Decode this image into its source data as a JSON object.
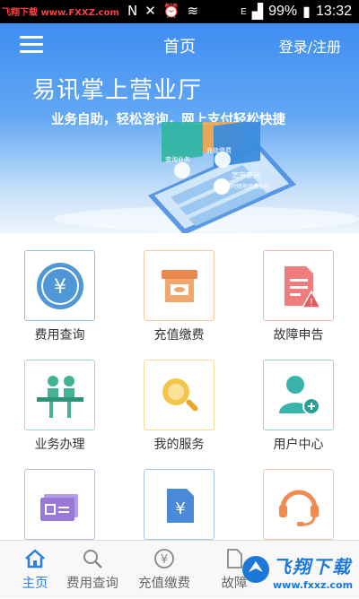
{
  "statusbar": {
    "watermark": "飞翔下载 www.FXXZ.com",
    "battery": "99%",
    "time": "13:32",
    "network_label": "E"
  },
  "header": {
    "title": "首页",
    "login_label": "登录/注册"
  },
  "banner": {
    "slogan": "易讯掌上营业厅",
    "tagline": "业务自助，轻松咨询，网上支付轻松快捷",
    "card_text_1": "查询业务",
    "card_text_2": "充值缴费",
    "card_text_3": "宽带查询",
    "card_text_4": "随时随地资费查询"
  },
  "grid": {
    "items": [
      {
        "label": "费用查询",
        "icon": "yen-coin-icon",
        "color": "#5aa0d8"
      },
      {
        "label": "充值缴费",
        "icon": "atm-card-icon",
        "color": "#f0a060"
      },
      {
        "label": "故障申告",
        "icon": "document-warning-icon",
        "color": "#ee7a7a"
      },
      {
        "label": "业务办理",
        "icon": "counter-service-icon",
        "color": "#4ab89a"
      },
      {
        "label": "我的服务",
        "icon": "magnifier-icon",
        "color": "#f3c24a"
      },
      {
        "label": "用户中心",
        "icon": "user-add-icon",
        "color": "#3ab7b0"
      },
      {
        "label": "",
        "icon": "id-card-icon",
        "color": "#9a78d8"
      },
      {
        "label": "",
        "icon": "yen-document-icon",
        "color": "#4a8ad8"
      },
      {
        "label": "",
        "icon": "headset-icon",
        "color": "#f08a50"
      }
    ]
  },
  "tabbar": {
    "tabs": [
      {
        "label": "主页",
        "icon": "home-icon"
      },
      {
        "label": "费用查询",
        "icon": "search-icon"
      },
      {
        "label": "充值缴费",
        "icon": "yen-circle-icon"
      },
      {
        "label": "故障",
        "icon": "document-icon"
      }
    ]
  },
  "brand": {
    "name": "飞翔下载",
    "url": "www.fxxz.com"
  }
}
